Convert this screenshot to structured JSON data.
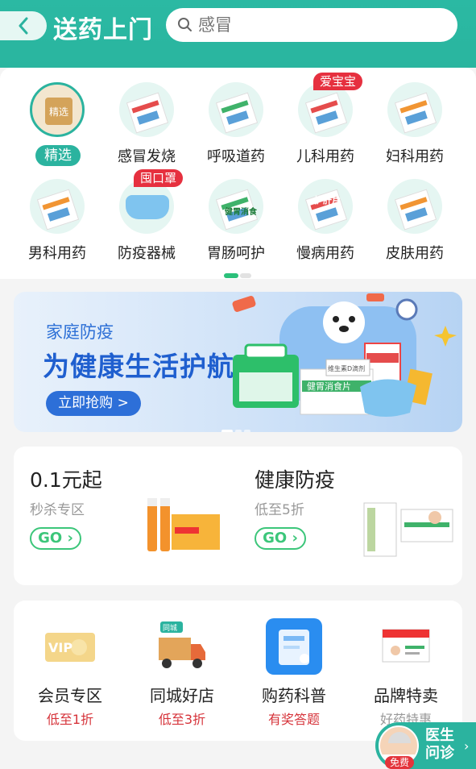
{
  "header": {
    "title": "送药上门",
    "search_placeholder": "感冒"
  },
  "categories": [
    {
      "label": "精选",
      "selected": true,
      "badge_text": "精选"
    },
    {
      "label": "感冒发烧"
    },
    {
      "label": "呼吸道药"
    },
    {
      "label": "儿科用药",
      "tag": "爱宝宝"
    },
    {
      "label": "妇科用药"
    },
    {
      "label": "男科用药"
    },
    {
      "label": "防疫器械",
      "tag": "囤口罩"
    },
    {
      "label": "胃肠呵护",
      "pkg_text": "健胃消食"
    },
    {
      "label": "慢病用药",
      "pkg_text": "护肝片"
    },
    {
      "label": "皮肤用药"
    }
  ],
  "banner": {
    "subtitle": "家庭防疫",
    "headline": "为健康生活护航",
    "cta": "立即抢购 >",
    "product_text_1": "健胃消食片",
    "product_text_2": "维生素D滴剂"
  },
  "promo": {
    "left": {
      "title": "0.1元起",
      "subtitle": "秒杀专区",
      "go": "GO"
    },
    "right": {
      "title": "健康防疫",
      "subtitle": "低至5折",
      "go": "GO"
    }
  },
  "services": [
    {
      "name": "会员专区",
      "desc": "低至1折",
      "desc_color": "red",
      "icon": "vip-card-icon",
      "icon_text": "VIP"
    },
    {
      "name": "同城好店",
      "desc": "低至3折",
      "desc_color": "red",
      "icon": "delivery-truck-icon",
      "icon_text": "同城"
    },
    {
      "name": "购药科普",
      "desc": "有奖答题",
      "desc_color": "red",
      "icon": "medicine-box-icon"
    },
    {
      "name": "品牌特卖",
      "desc": "好药特惠",
      "desc_color": "gray",
      "icon": "brand-box-icon"
    }
  ],
  "doctor": {
    "label": "医生问诊",
    "free": "免费"
  },
  "colors": {
    "primary": "#2bb39f",
    "accent_blue": "#2d6fd8",
    "go_green": "#3cc67a",
    "sale_red": "#d6333a"
  }
}
